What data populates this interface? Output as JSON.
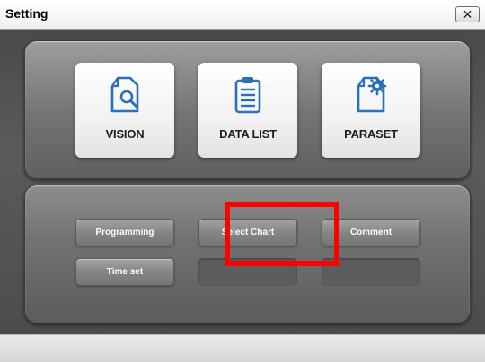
{
  "window": {
    "title": "Setting",
    "cut_off_title_fragment": "g",
    "close_glyph": "✕"
  },
  "top_panel": {
    "buttons": [
      {
        "label": "VISION",
        "icon": "document-search-icon"
      },
      {
        "label": "DATA LIST",
        "icon": "clipboard-list-icon"
      },
      {
        "label": "PARASET",
        "icon": "document-gear-icon"
      }
    ]
  },
  "bottom_panel": {
    "buttons": [
      {
        "label": "Programming"
      },
      {
        "label": "Select Chart"
      },
      {
        "label": "Comment"
      },
      {
        "label": "Time set"
      }
    ]
  },
  "highlight": {
    "color": "#ff0000"
  },
  "colors": {
    "icon_blue": "#2a6fb8",
    "panel_gray": "#737373"
  }
}
